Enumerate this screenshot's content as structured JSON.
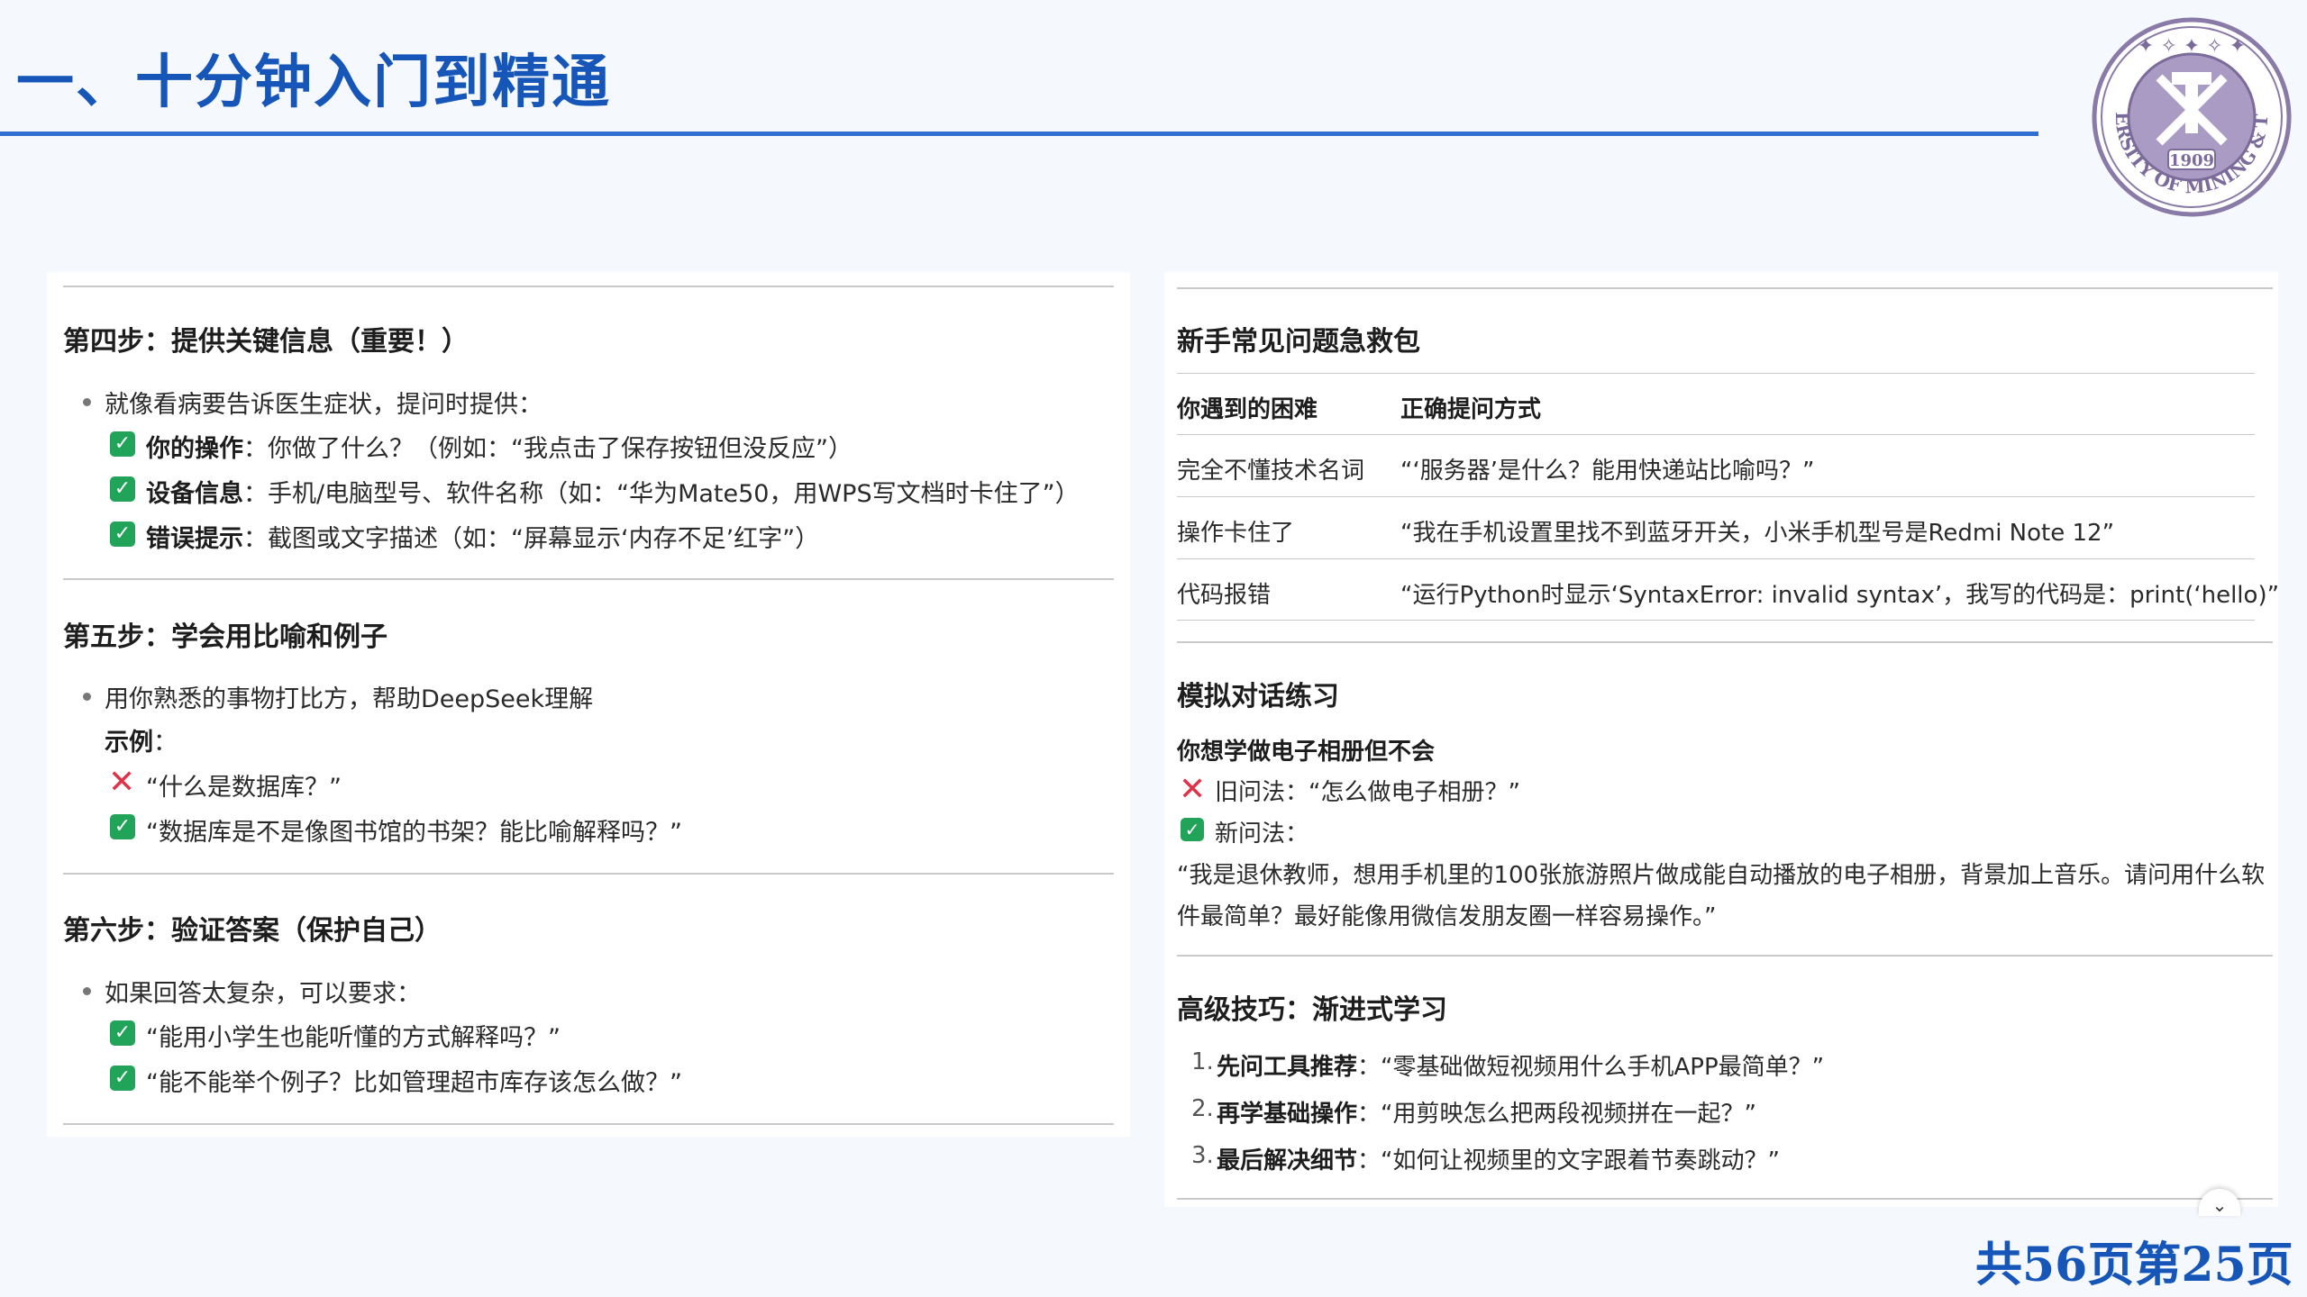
{
  "slide": {
    "title": "一、十分钟入门到精通",
    "page_counter": "共56页第25页",
    "colors": {
      "title": "#1556b8",
      "rule": "#2e6fd0",
      "check": "#22a35a",
      "cross": "#e0334a"
    }
  },
  "logo": {
    "year": "1909",
    "ring_text": "CHINA UNIVERSITY OF MINING & TECHNOLOGY",
    "icon": "university-seal"
  },
  "left": {
    "step4": {
      "title": "第四步：提供关键信息（重要！）",
      "intro": "就像看病要告诉医生症状，提问时提供：",
      "items": [
        {
          "label": "你的操作",
          "text": "：你做了什么？（例如：“我点击了保存按钮但没反应”）"
        },
        {
          "label": "设备信息",
          "text": "：手机/电脑型号、软件名称（如：“华为Mate50，用WPS写文档时卡住了”）"
        },
        {
          "label": "错误提示",
          "text": "：截图或文字描述（如：“屏幕显示‘内存不足’红字”）"
        }
      ]
    },
    "step5": {
      "title": "第五步：学会用比喻和例子",
      "intro": "用你熟悉的事物打比方，帮助DeepSeek理解",
      "example_label": "示例",
      "example_colon": "：",
      "bad": "“什么是数据库？”",
      "good": "“数据库是不是像图书馆的书架？能比喻解释吗？”"
    },
    "step6": {
      "title": "第六步：验证答案（保护自己）",
      "intro": "如果回答太复杂，可以要求：",
      "items": [
        "“能用小学生也能听懂的方式解释吗？”",
        "“能不能举个例子？比如管理超市库存该怎么做？”"
      ]
    }
  },
  "right": {
    "help": {
      "title": "新手常见问题急救包",
      "headers": [
        "你遇到的困难",
        "正确提问方式"
      ],
      "rows": [
        [
          "完全不懂技术名词",
          "“‘服务器’是什么？能用快递站比喻吗？”"
        ],
        [
          "操作卡住了",
          "“我在手机设置里找不到蓝牙开关，小米手机型号是Redmi Note 12”"
        ],
        [
          "代码报错",
          "“运行Python时显示‘SyntaxError: invalid syntax’，我写的代码是：print(‘hello)”"
        ]
      ]
    },
    "practice": {
      "title": "模拟对话练习",
      "scenario": "你想学做电子相册但不会",
      "old": "旧问法：“怎么做电子相册？”",
      "new_label": "新问法：",
      "new_line1": "“我是退休教师，想用手机里的100张旅游照片做成能自动播放的电子相册，背景加上音乐。请问用什么软",
      "new_line2": "件最简单？最好能像用微信发朋友圈一样容易操作。”"
    },
    "advanced": {
      "title": "高级技巧：渐进式学习",
      "steps": [
        {
          "num": "1.",
          "label": "先问工具推荐",
          "text": "：“零基础做短视频用什么手机APP最简单？”"
        },
        {
          "num": "2.",
          "label": "再学基础操作",
          "text": "：“用剪映怎么把两段视频拼在一起？”"
        },
        {
          "num": "3.",
          "label": "最后解决细节",
          "text": "：“如何让视频里的文字跟着节奏跳动？”"
        }
      ]
    }
  }
}
